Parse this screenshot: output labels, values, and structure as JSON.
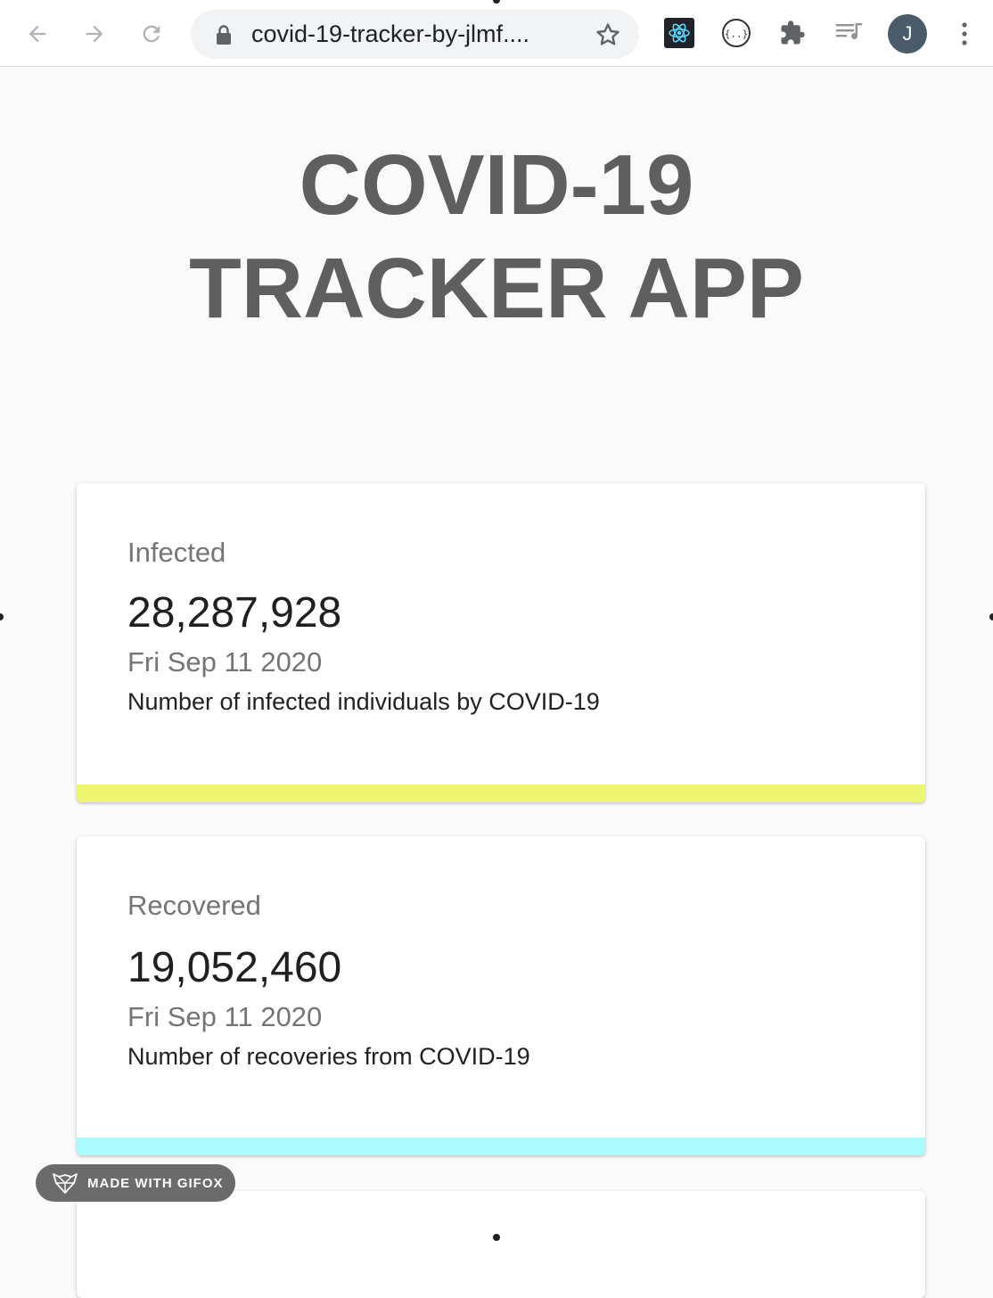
{
  "browser": {
    "url": "covid-19-tracker-by-jlmf....",
    "avatar_initial": "J"
  },
  "page": {
    "title_line1": "COVID-19",
    "title_line2": "TRACKER APP"
  },
  "cards": [
    {
      "label": "Infected",
      "value": "28,287,928",
      "date": "Fri Sep 11 2020",
      "description": "Number of infected individuals by COVID-19",
      "accent_color": "#eef571"
    },
    {
      "label": "Recovered",
      "value": "19,052,460",
      "date": "Fri Sep 11 2020",
      "description": "Number of recoveries from COVID-19",
      "accent_color": "#a9fbff"
    }
  ],
  "watermark": {
    "text": "MADE WITH GIFOX"
  }
}
